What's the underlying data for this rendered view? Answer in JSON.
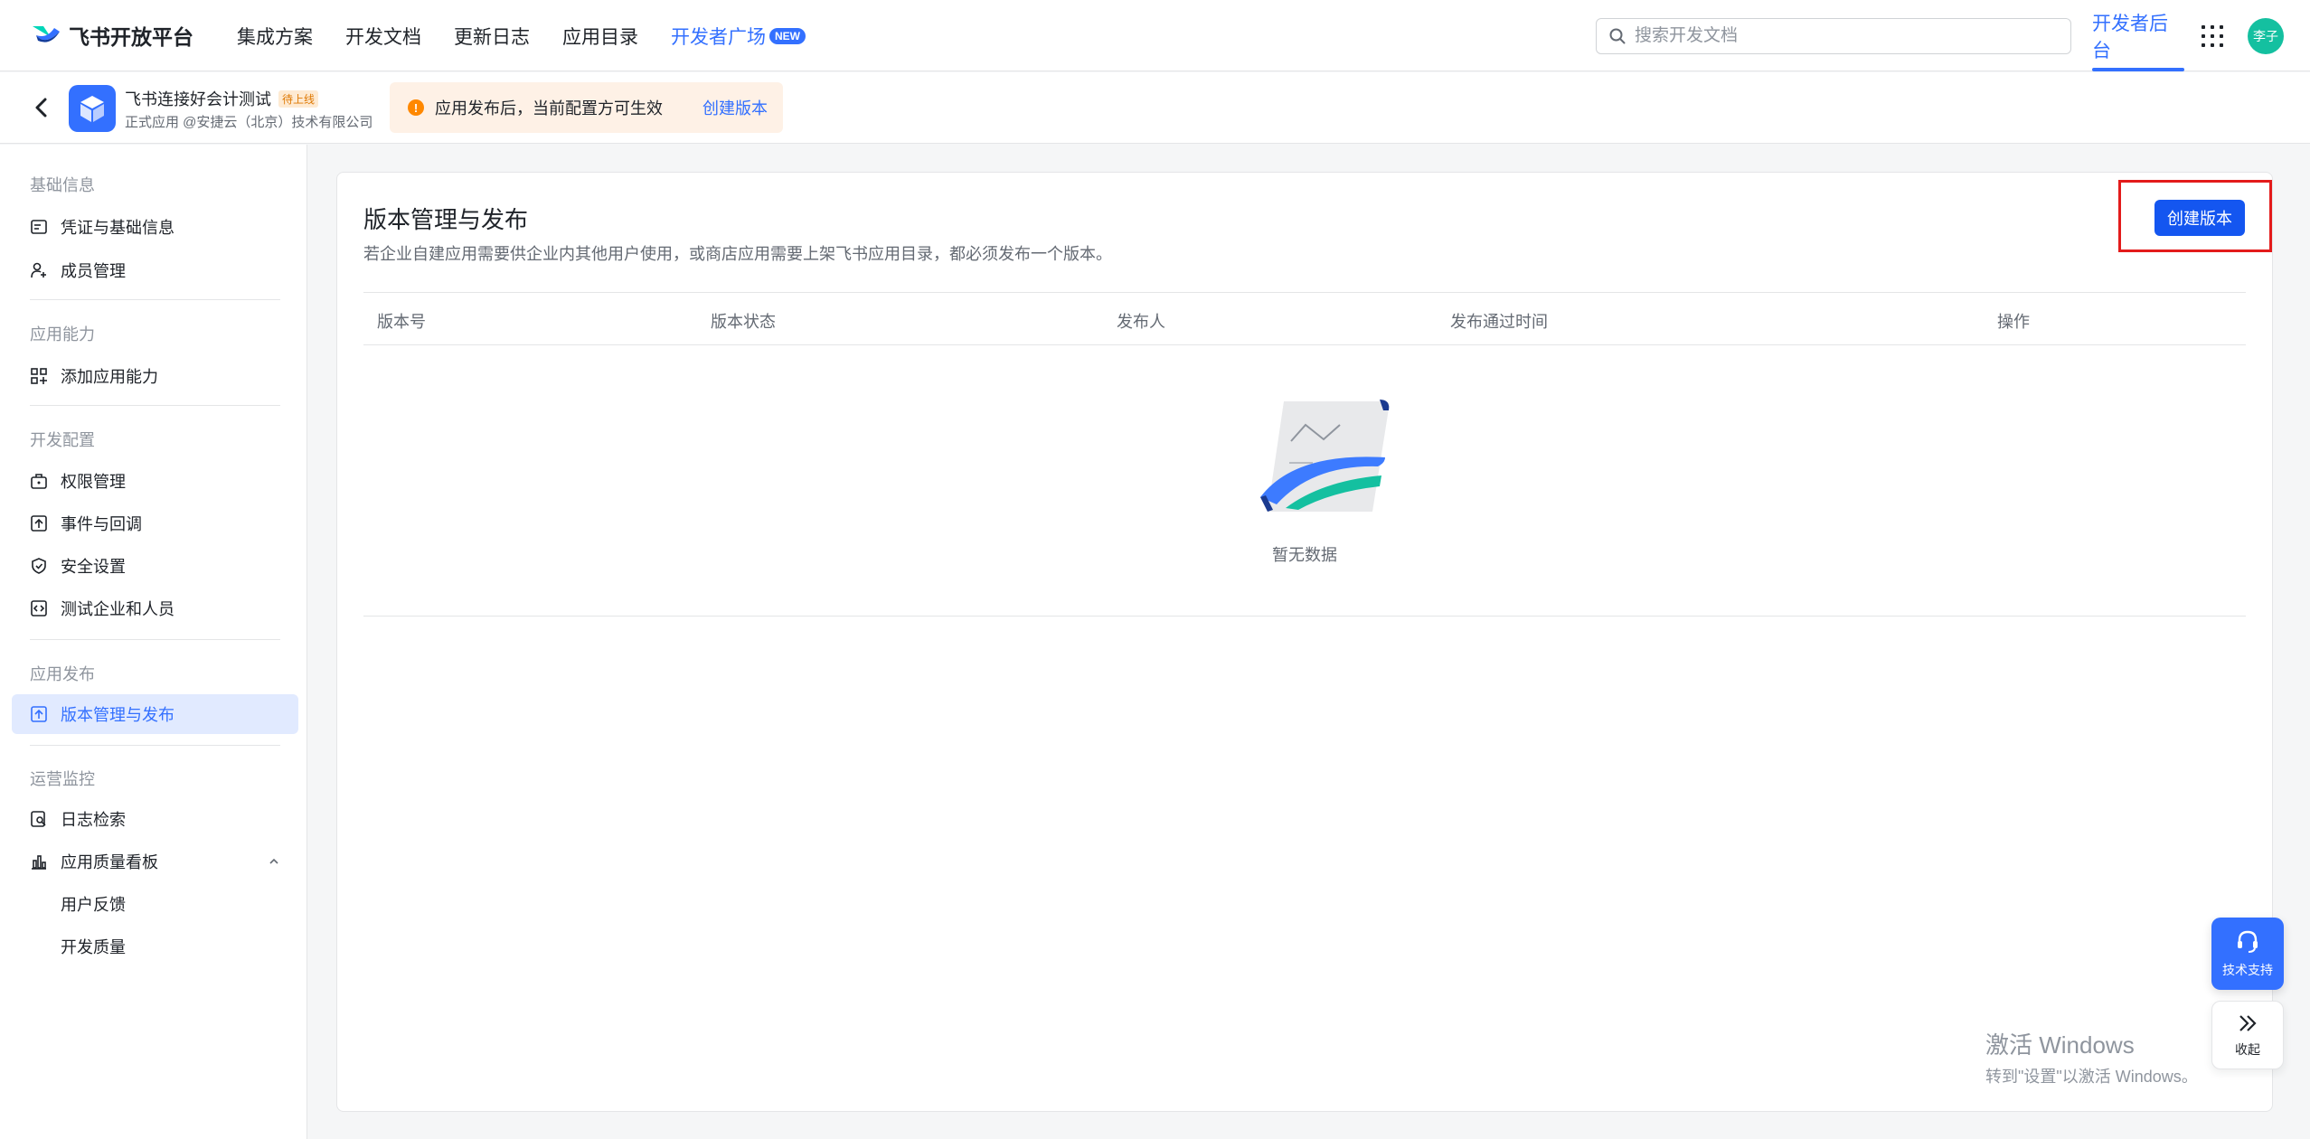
{
  "brand": {
    "name": "飞书开放平台"
  },
  "nav": {
    "items": [
      {
        "label": "集成方案"
      },
      {
        "label": "开发文档"
      },
      {
        "label": "更新日志"
      },
      {
        "label": "应用目录"
      },
      {
        "label": "开发者广场",
        "badge": "NEW"
      }
    ],
    "search_placeholder": "搜索开发文档",
    "console_label": "开发者后台",
    "avatar_text": "李子"
  },
  "app": {
    "name": "飞书连接好会计测试",
    "status_badge": "待上线",
    "meta": "正式应用 @安捷云（北京）技术有限公司",
    "notice_text": "应用发布后，当前配置方可生效",
    "notice_link": "创建版本"
  },
  "sidebar": {
    "sections": [
      {
        "title": "基础信息",
        "items": [
          "凭证与基础信息",
          "成员管理"
        ]
      },
      {
        "title": "应用能力",
        "items": [
          "添加应用能力"
        ]
      },
      {
        "title": "开发配置",
        "items": [
          "权限管理",
          "事件与回调",
          "安全设置",
          "测试企业和人员"
        ]
      },
      {
        "title": "应用发布",
        "items": [
          "版本管理与发布"
        ]
      },
      {
        "title": "运营监控",
        "items": [
          "日志检索",
          "应用质量看板"
        ],
        "subitems": [
          "用户反馈",
          "开发质量"
        ]
      }
    ],
    "active_item": "版本管理与发布"
  },
  "main": {
    "title": "版本管理与发布",
    "description": "若企业自建应用需要供企业内其他用户使用，或商店应用需要上架飞书应用目录，都必须发布一个版本。",
    "create_button": "创建版本",
    "columns": [
      "版本号",
      "版本状态",
      "发布人",
      "发布通过时间",
      "操作"
    ],
    "rows": [],
    "empty_text": "暂无数据"
  },
  "floating": {
    "support_label": "技术支持",
    "collapse_label": "收起"
  },
  "watermark": {
    "line1": "激活 Windows",
    "line2": "转到\"设置\"以激活 Windows。"
  },
  "colors": {
    "accent": "#3370ff",
    "primary_button": "#1456f0",
    "highlight_outline": "#e31b1b",
    "notice_bg": "#fef1e6",
    "avatar_bg": "#14c0a0"
  }
}
